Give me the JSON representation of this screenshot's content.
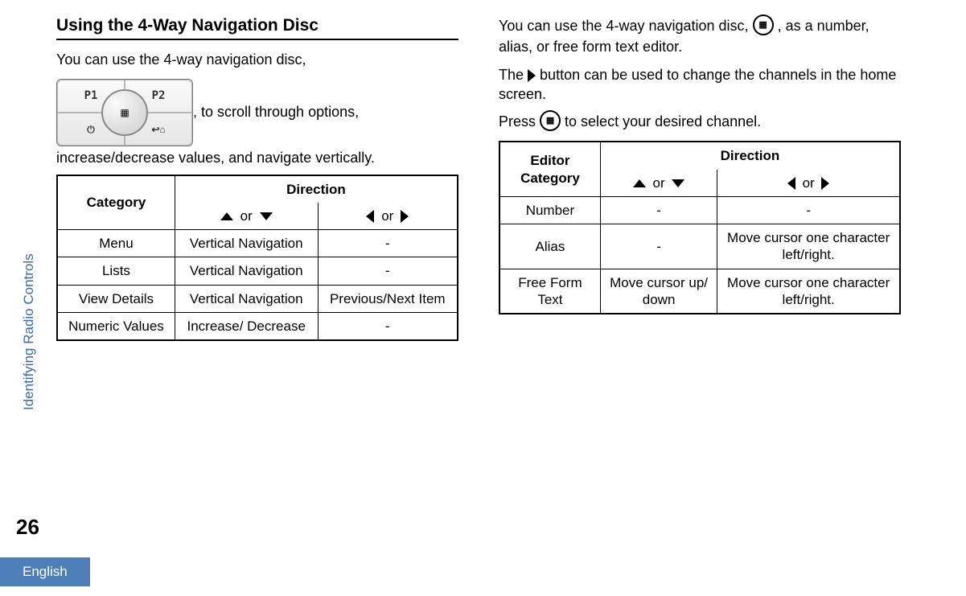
{
  "sidebar_label": "Identifying Radio Controls",
  "page_number": "26",
  "language_tab": "English",
  "left": {
    "title": "Using the 4-Way Navigation Disc",
    "intro_before": "You can use the 4-way navigation disc,",
    "intro_after": ", to scroll through options, increase/decrease values, and navigate vertically.",
    "nav_btn_p1": "P1",
    "nav_btn_p2": "P2",
    "nav_btn_power": "⏻",
    "nav_btn_home": "↩⌂",
    "nav_btn_center": "▦",
    "table": {
      "h_category": "Category",
      "h_direction": "Direction",
      "or": "or",
      "rows": [
        {
          "c": "Menu",
          "d1": "Vertical Navigation",
          "d2": "-"
        },
        {
          "c": "Lists",
          "d1": "Vertical Navigation",
          "d2": "-"
        },
        {
          "c": "View Details",
          "d1": "Vertical Navigation",
          "d2": "Previous/Next Item"
        },
        {
          "c": "Numeric Values",
          "d1": "Increase/ Decrease",
          "d2": "-"
        }
      ]
    }
  },
  "right": {
    "intro_before": "You can use the 4-way navigation disc, ",
    "intro_after": ", as a number, alias, or free form text editor.",
    "disc_glyph": "▦",
    "p2_before": "The ",
    "p2_after": " button can be used to change the channels in the home screen.",
    "p3_before": "Press ",
    "p3_after": " to select your desired channel.",
    "table": {
      "h_category": "Editor Category",
      "h_direction": "Direction",
      "or": "or",
      "rows": [
        {
          "c": "Number",
          "d1": "-",
          "d2": "-"
        },
        {
          "c": "Alias",
          "d1": "-",
          "d2": "Move cursor one character left/right."
        },
        {
          "c": "Free Form Text",
          "d1": "Move cursor up/ down",
          "d2": "Move cursor one character left/right."
        }
      ]
    }
  }
}
